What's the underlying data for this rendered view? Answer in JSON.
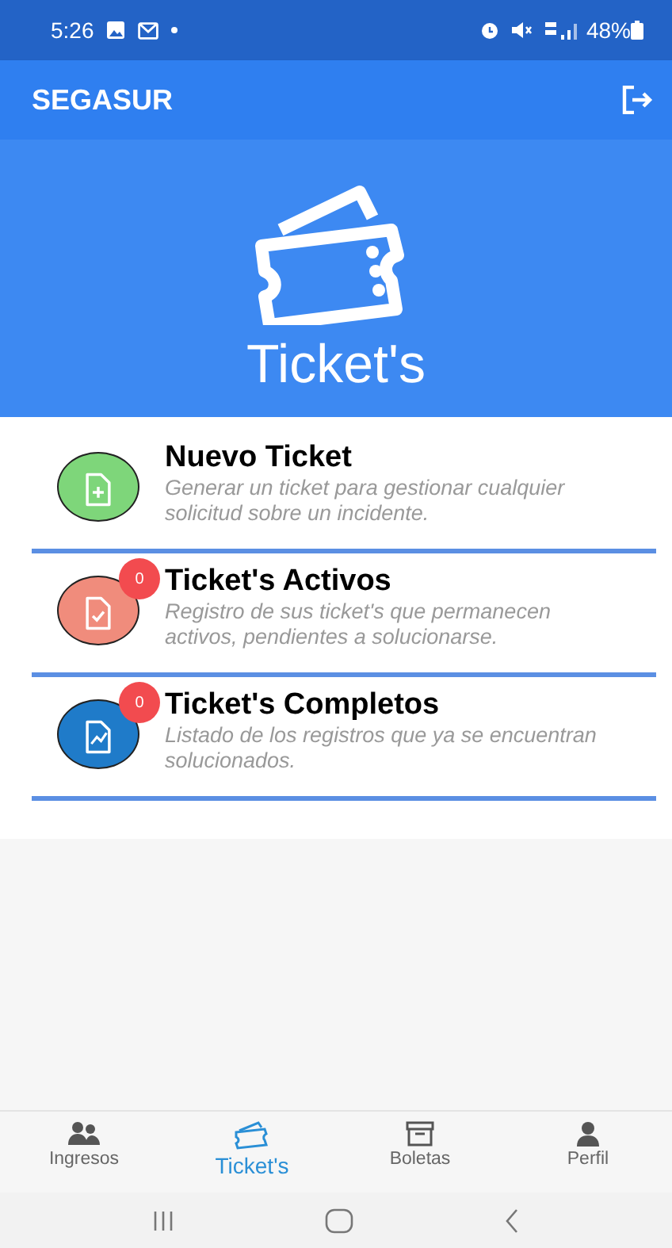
{
  "status_bar": {
    "time": "5:26",
    "battery": "48%"
  },
  "app_bar": {
    "title": "SEGASUR"
  },
  "hero": {
    "title": "Ticket's"
  },
  "menu": [
    {
      "title": "Nuevo Ticket",
      "description": "Generar un ticket para gestionar cualquier solicitud sobre un incidente.",
      "color": "#7ed67a",
      "kind": "new"
    },
    {
      "title": "Ticket's Activos",
      "description": "Registro de sus ticket's que permanecen activos, pendientes a solucionarse.",
      "color": "#f08c7c",
      "kind": "active",
      "badge": "0"
    },
    {
      "title": "Ticket's Completos",
      "description": "Listado de los registros que ya se encuentran solucionados.",
      "color": "#1f7bc9",
      "kind": "done",
      "badge": "0"
    }
  ],
  "bottom_nav": [
    {
      "label": "Ingresos",
      "kind": "people",
      "selected": false
    },
    {
      "label": "Ticket's",
      "kind": "tickets",
      "selected": true
    },
    {
      "label": "Boletas",
      "kind": "archive",
      "selected": false
    },
    {
      "label": "Perfil",
      "kind": "person",
      "selected": false
    }
  ]
}
